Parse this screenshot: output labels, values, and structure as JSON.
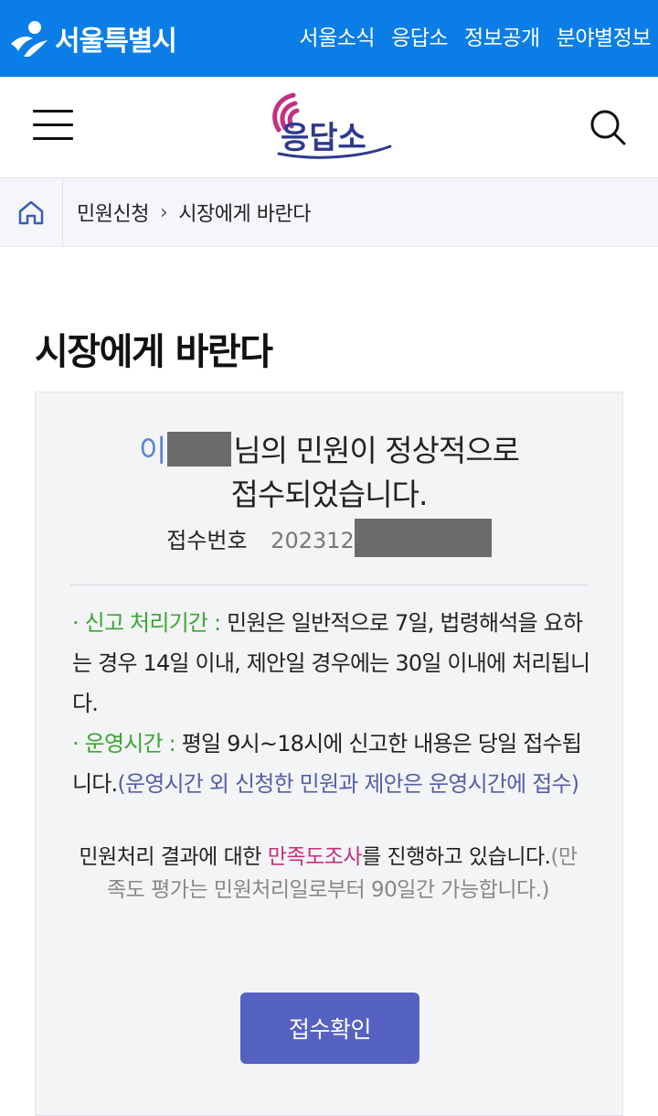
{
  "topbar": {
    "site_name": "서울특별시",
    "nav": [
      "서울소식",
      "응답소",
      "정보공개",
      "분야별정보"
    ],
    "color": "#0a7ee6"
  },
  "header": {
    "logo_text": "응답소",
    "menu_icon": "hamburger-icon",
    "search_icon": "search-icon"
  },
  "breadcrumb": {
    "home_icon": "home-icon",
    "items": [
      "민원신청",
      "시장에게 바란다"
    ]
  },
  "page_title": "시장에게 바란다",
  "result": {
    "name_visible": "이",
    "message_line1_suffix": "님의 민원이 정상적으로",
    "message_line2": "접수되었습니다.",
    "receipt_label": "접수번호",
    "receipt_number_visible": "202312"
  },
  "info": {
    "item1_label": "신고 처리기간 :",
    "item1_text": " 민원은 일반적으로 7일, 법령해석을 요하는 경우 14일 이내, 제안일 경우에는 30일 이내에 처리됩니다.",
    "item2_label": "운영시간 :",
    "item2_text": " 평일 9시~18시에 신고한 내용은 당일 접수됩니다.",
    "item2_paren": "(운영시간 외 신청한 민원과 제안은 운영시간에 접수)"
  },
  "survey": {
    "prefix": "민원처리 결과에 대한 ",
    "highlight": "만족도조사",
    "suffix": "를 진행하고 있습니다.",
    "sub": "(만족도 평가는 민원처리일로부터 90일간 가능합니다.)"
  },
  "confirm_button": "접수확인"
}
